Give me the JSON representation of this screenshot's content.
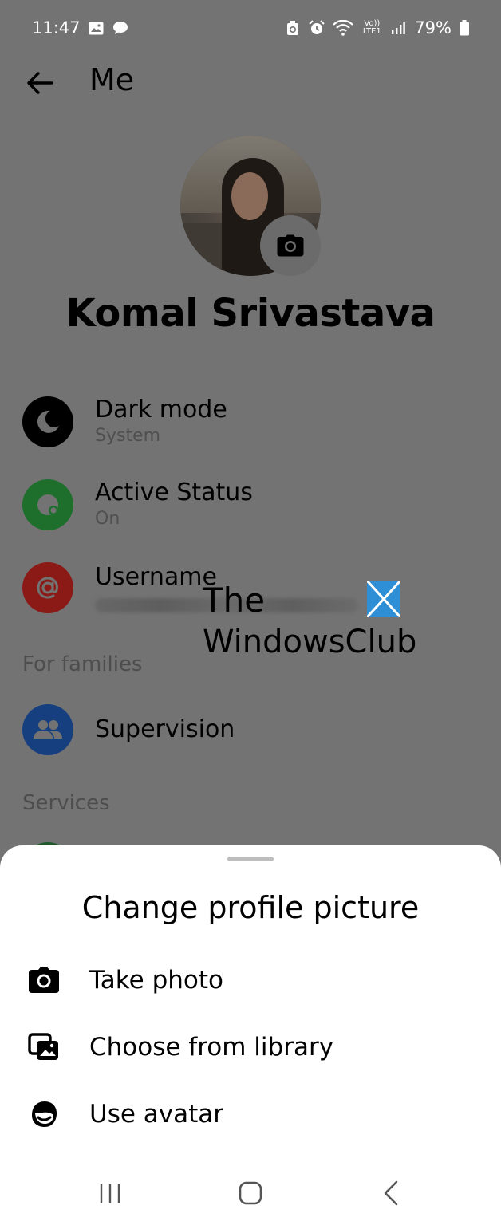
{
  "status_bar": {
    "time": "11:47",
    "battery": "79%",
    "left_icons": [
      "gallery-icon",
      "chat-bubble-icon"
    ],
    "right_icons": [
      "recycle-icon",
      "alarm-icon",
      "wifi-icon",
      "volte-icon",
      "signal-icon",
      "battery-icon"
    ],
    "volte_label": "Vo)) LTE1"
  },
  "header": {
    "title": "Me",
    "back_icon": "arrow-left-icon"
  },
  "profile": {
    "name": "Komal Srivastava",
    "camera_icon": "camera-icon"
  },
  "settings": [
    {
      "title": "Dark mode",
      "subtitle": "System",
      "icon": "moon-icon",
      "icon_bg": "#000000"
    },
    {
      "title": "Active Status",
      "subtitle": "On",
      "icon": "active-status-icon",
      "icon_bg": "#1e6e2c"
    },
    {
      "title": "Username",
      "subtitle": "",
      "icon": "at-sign-icon",
      "icon_bg": "#8b1a16"
    }
  ],
  "sections": {
    "families_header": "For families",
    "supervision_label": "Supervision",
    "services_header": "Services"
  },
  "watermark": {
    "line1": "The",
    "line2": "WindowsClub",
    "logo_color": "#2f8fd6"
  },
  "sheet": {
    "title": "Change profile picture",
    "options": [
      {
        "label": "Take photo",
        "icon": "camera-icon"
      },
      {
        "label": "Choose from library",
        "icon": "photo-library-icon"
      },
      {
        "label": "Use avatar",
        "icon": "avatar-face-icon"
      }
    ]
  },
  "nav_bar": {
    "buttons": [
      "recent-apps-icon",
      "home-icon",
      "back-chevron-icon"
    ]
  },
  "colors": {
    "scrim": "#737373",
    "sheet_bg": "#ffffff",
    "supervision_blue": "#163f80"
  }
}
